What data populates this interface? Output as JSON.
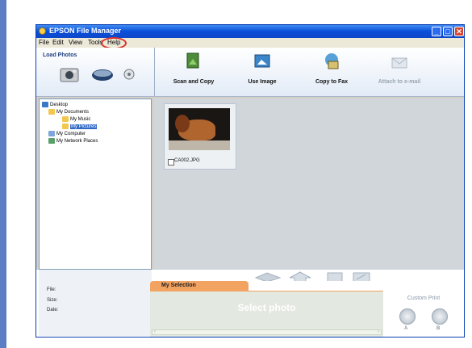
{
  "window": {
    "title": "EPSON File Manager",
    "buttons": {
      "minimize": "_",
      "maximize": "□",
      "close": "✕"
    }
  },
  "menu": [
    "File",
    "Edit",
    "View",
    "Tools",
    "Help"
  ],
  "load_panel": {
    "label": "Load Photos"
  },
  "toolbar": {
    "buttons": [
      {
        "label": "Scan and Copy",
        "enabled": true
      },
      {
        "label": "Use Image",
        "enabled": true
      },
      {
        "label": "Copy to Fax",
        "enabled": true
      },
      {
        "label": "Attach to e-mail",
        "enabled": false
      }
    ]
  },
  "tree": {
    "items": [
      {
        "label": "Desktop"
      },
      {
        "label": "My Documents"
      },
      {
        "label": "My Music"
      },
      {
        "label": "My Pictures",
        "selected": true
      },
      {
        "label": "My Computer"
      },
      {
        "label": "My Network Places"
      }
    ]
  },
  "thumbnails": [
    {
      "filename": "CA002.JPG",
      "checked": false
    }
  ],
  "info": {
    "file_label": "File:",
    "size_label": "Size:",
    "date_label": "Date:"
  },
  "selection": {
    "tab_label": "My Selection",
    "placeholder": "Select photo"
  },
  "custom_print": {
    "label": "Custom Print",
    "a": "A",
    "b": "B"
  },
  "colors": {
    "highlight": "#316ac5",
    "tab": "#f2a261",
    "annotation": "#d8302a"
  }
}
